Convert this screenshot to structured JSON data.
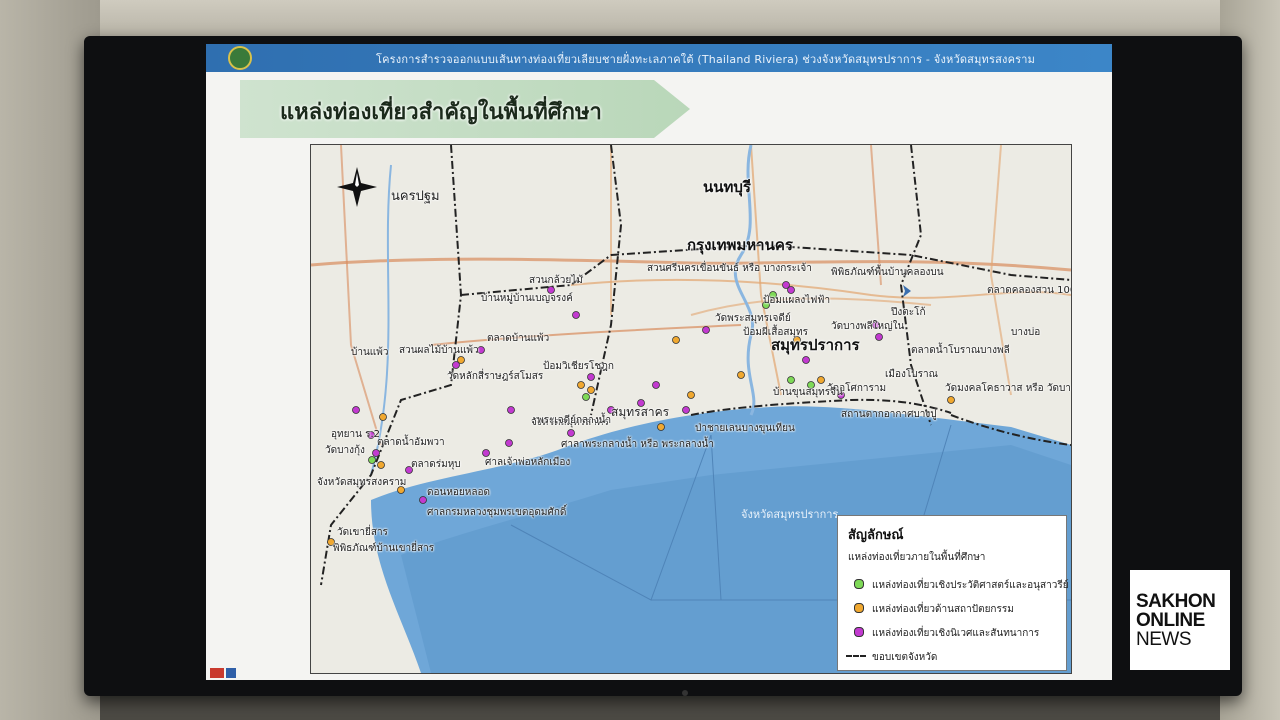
{
  "header": {
    "project_title": "โครงการสำรวจออกแบบเส้นทางท่องเที่ยวเลียบชายฝั่งทะเลภาคใต้ (Thailand Riviera) ช่วงจังหวัดสมุทรปราการ - จังหวัดสมุทรสงคราม"
  },
  "slide": {
    "title": "แหล่งท่องเที่ยวสำคัญในพื้นที่ศึกษา"
  },
  "map": {
    "place_labels": [
      {
        "text": "กรุงเทพมหานคร",
        "size": "big"
      },
      {
        "text": "นนทบุรี",
        "size": "big"
      },
      {
        "text": "นครปฐม",
        "size": "normal"
      },
      {
        "text": "สมุทรปราการ",
        "size": "big"
      },
      {
        "text": "สมุทรสาคร",
        "size": "normal"
      },
      {
        "text": "ตลาดคลองสวน 100 ปี",
        "size": "normal"
      },
      {
        "text": "จังหวัดสมุทรปราการ",
        "size": "sea"
      },
      {
        "text": "จังหวัดสมุทรสาคร",
        "size": "normal"
      },
      {
        "text": "จังหวัดสมุทรสงคราม",
        "size": "normal"
      },
      {
        "text": "สวนศรีนครเขื่อนขันธ์ หรือ บางกระเจ้า",
        "size": "normal"
      },
      {
        "text": "พิพิธภัณฑ์พื้นบ้านคลองบน",
        "size": "normal"
      },
      {
        "text": "วัดพระสมุทรเจดีย์",
        "size": "normal"
      },
      {
        "text": "วัดอโศการาม",
        "size": "normal"
      },
      {
        "text": "สถานตากอากาศบางปู",
        "size": "normal"
      },
      {
        "text": "วัดมงคลโคธาวาส หรือ วัดบางเพ็ง",
        "size": "normal"
      },
      {
        "text": "ตลาดน้ำโบราณบางพลี",
        "size": "normal"
      },
      {
        "text": "บ้านขุนสมุทรจีน",
        "size": "normal"
      },
      {
        "text": "ศาลาพระกลางน้ำ หรือ พระกลางน้ำ",
        "size": "normal"
      },
      {
        "text": "ป่าชายเลนบางขุนเทียน",
        "size": "normal"
      },
      {
        "text": "พระเจดีย์กลางน้ำ",
        "size": "normal"
      },
      {
        "text": "ศาลเจ้าพ่อหลักเมือง",
        "size": "normal"
      },
      {
        "text": "ตลาดร่มหุบ",
        "size": "normal"
      },
      {
        "text": "อุทยาน ร.2",
        "size": "normal"
      },
      {
        "text": "วัดบางกุ้ง",
        "size": "normal"
      },
      {
        "text": "ตลาดน้ำอัมพวา",
        "size": "normal"
      },
      {
        "text": "วัดเขายี่สาร",
        "size": "normal"
      },
      {
        "text": "พิพิธภัณฑ์บ้านเขายี่สาร",
        "size": "normal"
      },
      {
        "text": "ดอนหอยหลอด",
        "size": "normal"
      },
      {
        "text": "ศาลกรมหลวงชุมพรเขตอุดมศักดิ์",
        "size": "normal"
      },
      {
        "text": "ป้อมวิเชียรโชฎก",
        "size": "normal"
      },
      {
        "text": "ตลาดบ้านแพ้ว",
        "size": "normal"
      },
      {
        "text": "สวนผลไม้บ้านแพ้ว",
        "size": "normal"
      },
      {
        "text": "วัดหลักสี่ราษฎร์สโมสร",
        "size": "normal"
      },
      {
        "text": "บ้านหมู่บ้านเบญจรงค์",
        "size": "normal"
      },
      {
        "text": "สวนกล้วยไม้",
        "size": "normal"
      },
      {
        "text": "ป้อมแผลงไฟฟ้า",
        "size": "normal"
      },
      {
        "text": "ป้อมผีเสื้อสมุทร",
        "size": "normal"
      },
      {
        "text": "เมืองโบราณ",
        "size": "normal"
      },
      {
        "text": "วัดบางพลีใหญ่ใน",
        "size": "normal"
      },
      {
        "text": "ปึงตะโก้",
        "size": "normal"
      },
      {
        "text": "บางบ่อ",
        "size": "normal"
      },
      {
        "text": "บ้านแพ้ว",
        "size": "normal"
      }
    ]
  },
  "legend": {
    "title": "สัญลักษณ์",
    "subtitle": "แหล่งท่องเที่ยวภายในพื้นที่ศึกษา",
    "items": [
      {
        "label": "แหล่งท่องเที่ยวเชิงประวัติศาสตร์และอนุสาวรีย์",
        "color": "#7ed957"
      },
      {
        "label": "แหล่งท่องเที่ยวด้านสถาปัตยกรรม",
        "color": "#f0a830"
      },
      {
        "label": "แหล่งท่องเที่ยวเชิงนิเวศและสันทนาการ",
        "color": "#c23ad0"
      }
    ],
    "boundary_label": "ขอบเขตจังหวัด"
  },
  "brand": {
    "line1": "SAKHON",
    "line2": "ONLINE",
    "line3": "NEWS"
  }
}
